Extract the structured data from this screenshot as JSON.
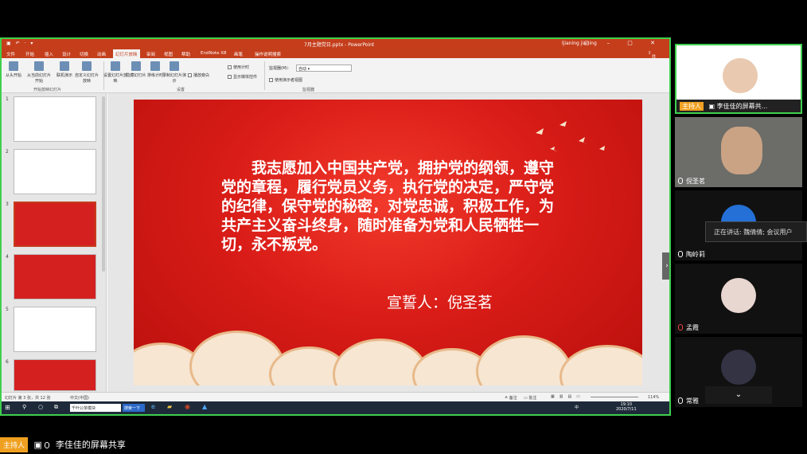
{
  "ppt": {
    "title": "7月主题党日.pptx - PowerPoint",
    "user": "ljianing jianing",
    "menu": [
      "文件",
      "开始",
      "插入",
      "设计",
      "切换",
      "动画",
      "幻灯片放映",
      "审阅",
      "视图",
      "帮助",
      "EndNote X8",
      "画笔",
      "操作说明搜索"
    ],
    "active_menu": "幻灯片放映",
    "share": "共享",
    "ribbon": {
      "from_start": "从头开始",
      "from_current": "从当前幻灯片开始",
      "online": "联机演示",
      "custom": "自定义幻灯片放映",
      "setup": "设置幻灯片放映",
      "hide": "隐藏幻灯片",
      "rehearse": "排练计时",
      "record": "录制幻灯片演示",
      "group1": "开始放映幻灯片",
      "group2": "设置",
      "group3": "监视器",
      "chk_narration": "播放旁白",
      "chk_timing": "使用计时",
      "chk_media": "显示媒体控件",
      "monitor_label": "监视器(M):",
      "monitor_value": "自动",
      "presenter": "使用演示者视图"
    },
    "slide": {
      "oath": "我志愿加入中国共产党，拥护党的纲领，遵守党的章程，履行党员义务，执行党的决定，严守党的纪律，保守党的秘密，对党忠诚，积极工作，为共产主义奋斗终身，随时准备为党和人民牺牲一切，永不叛党。",
      "signature": "宣誓人：倪圣茗"
    },
    "thumb_numbers": [
      "1",
      "2",
      "3",
      "4",
      "5",
      "6"
    ],
    "status": {
      "left": "幻灯片 第 3 张，共 12 张",
      "lang": "中文(中国)",
      "notes": "备注",
      "comments": "批注",
      "zoom": "114%"
    },
    "taskbar": {
      "search": "千叶公单模块",
      "btn": "搜索一下",
      "time": "19:10",
      "date": "2020/7/11",
      "ime": "中"
    }
  },
  "meeting": {
    "participants": [
      {
        "name": "李佳佳的屏幕共...",
        "role": "主持人"
      },
      {
        "name": "倪圣茗"
      },
      {
        "name": "陶岭莉"
      },
      {
        "name": "孟霞"
      },
      {
        "name": "常雅"
      }
    ],
    "tooltip": "正在讲话: 魏倩倩; 会议用户",
    "bottom_host": "主持人",
    "bottom_share": "李佳佳的屏幕共享"
  }
}
